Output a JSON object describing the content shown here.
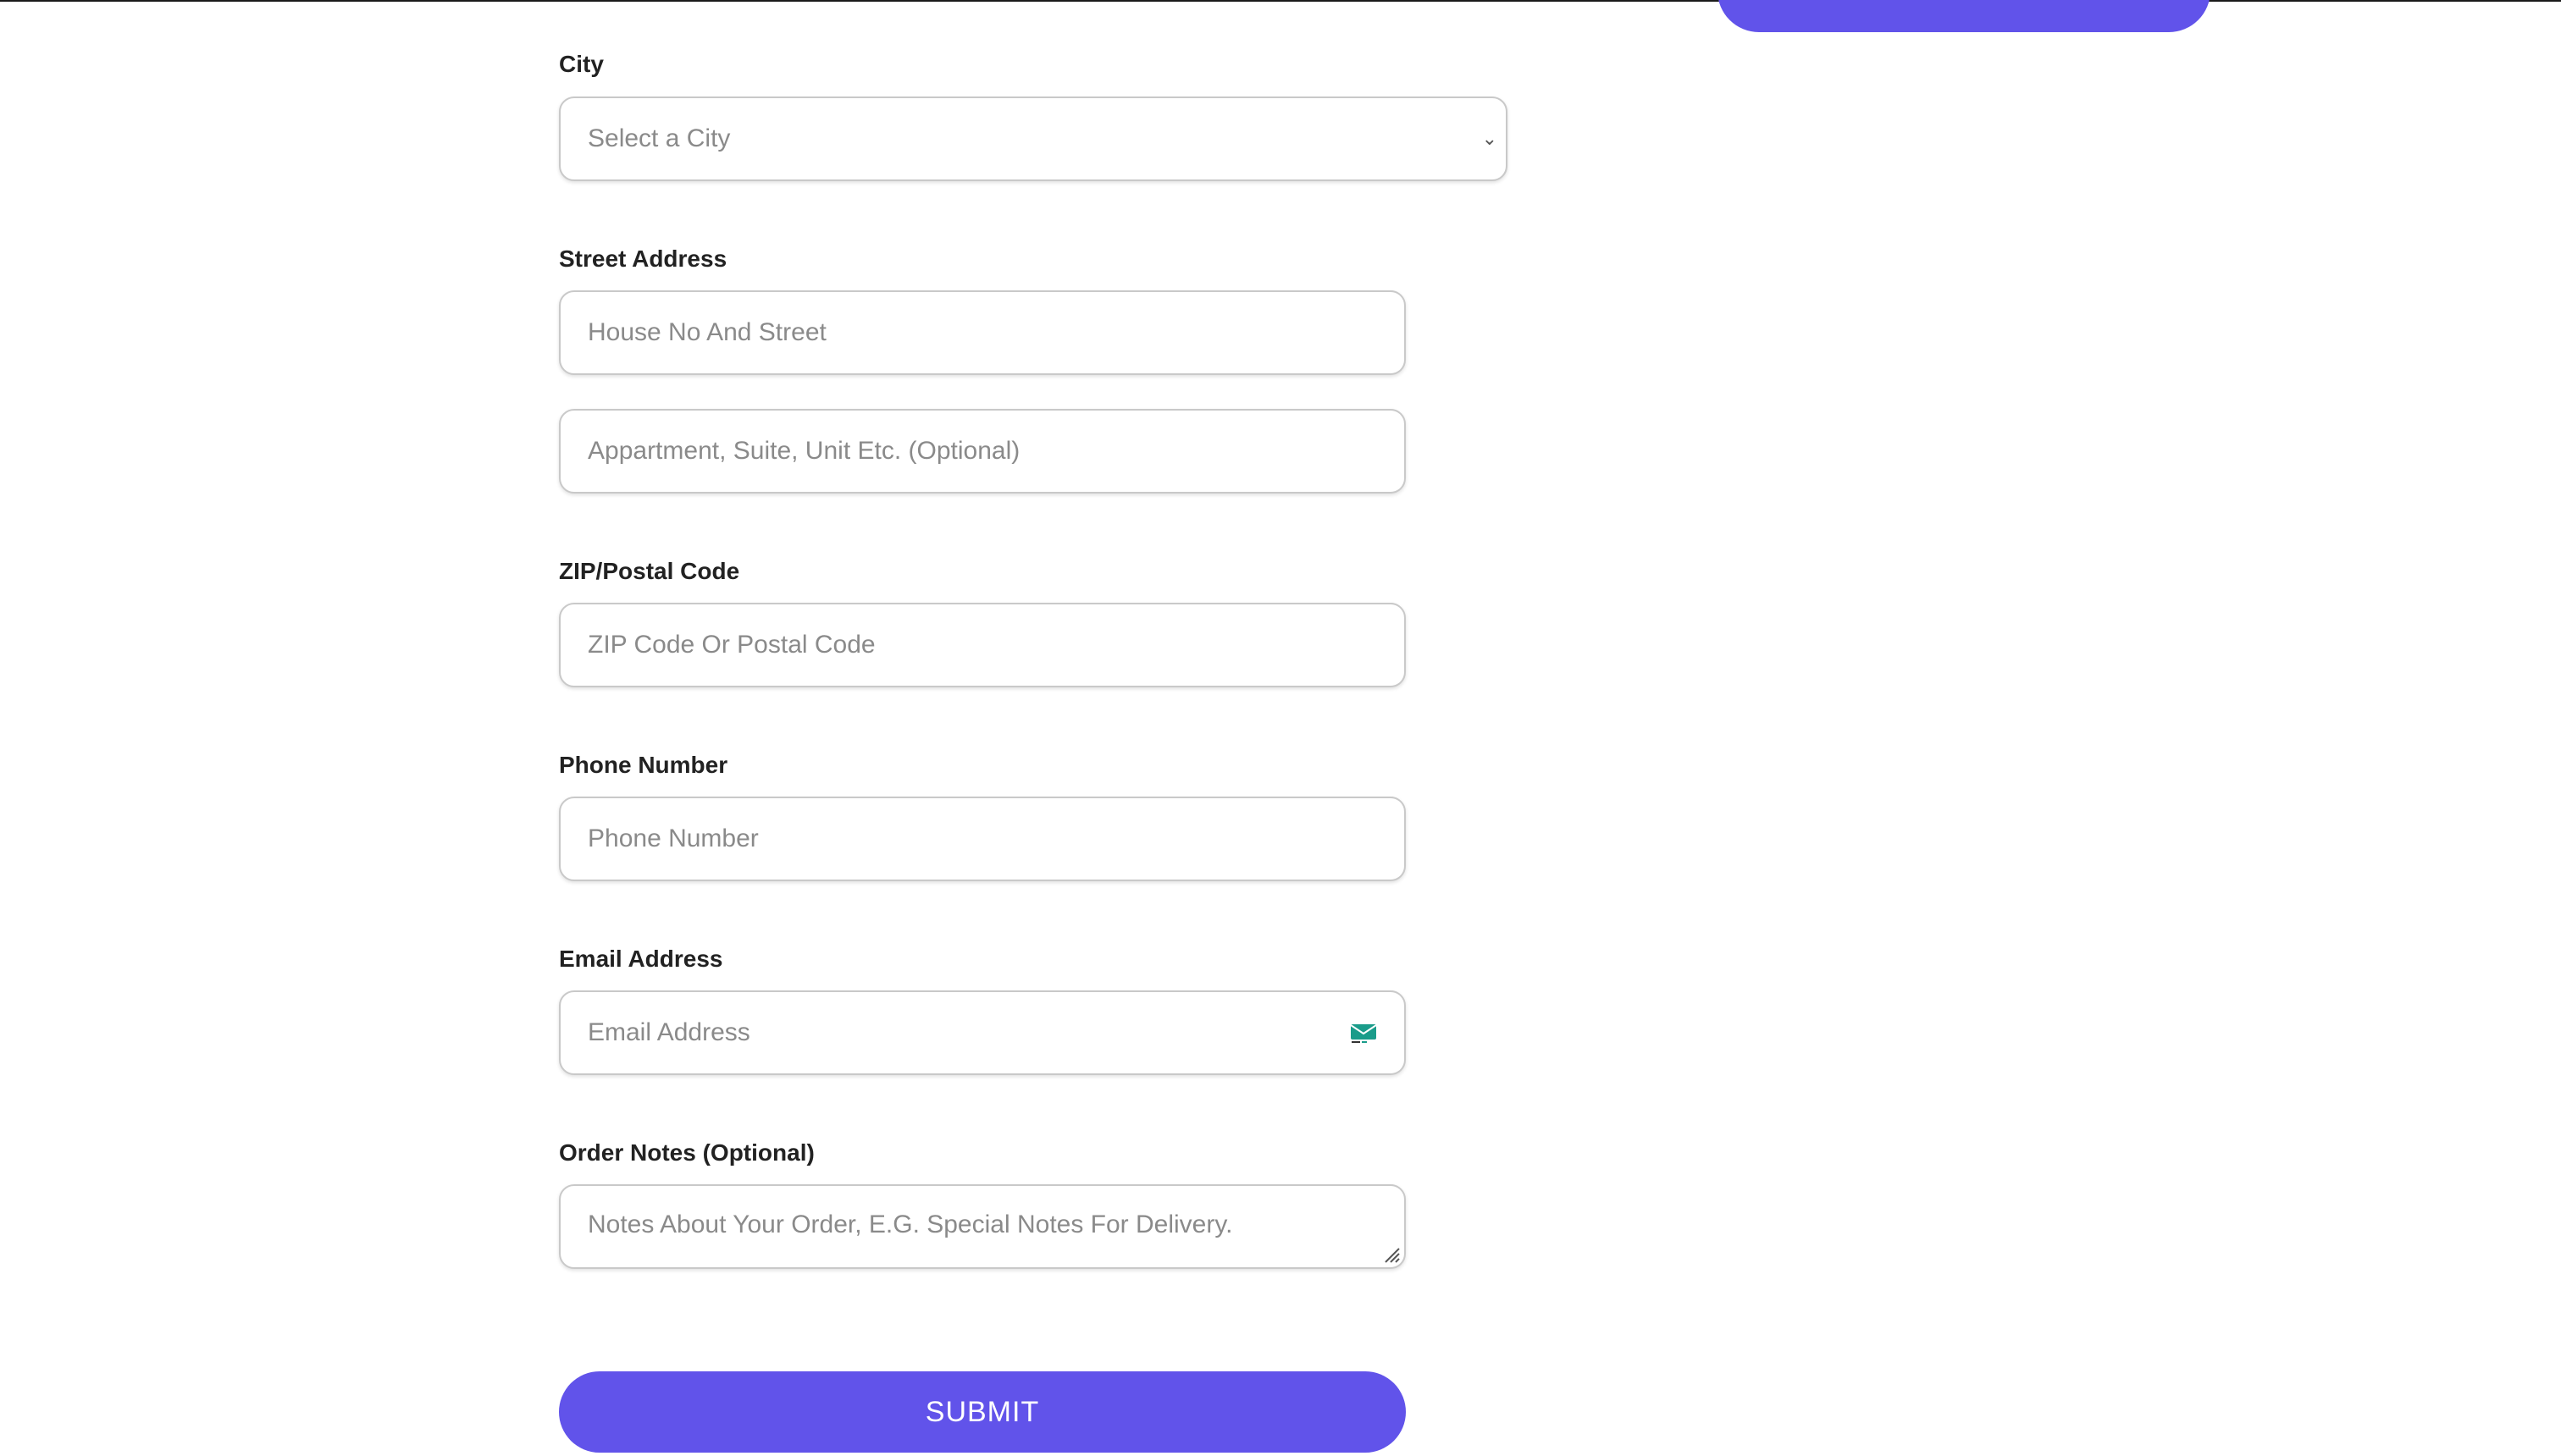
{
  "colors": {
    "accent": "#6153ea",
    "field_border": "#c9c9c9",
    "placeholder": "#8a8a8a",
    "label": "#222222",
    "mail_icon": "#1a9c8a"
  },
  "form": {
    "city": {
      "label": "City",
      "selected": "Select a City"
    },
    "street": {
      "label": "Street Address",
      "line1_placeholder": "House No And Street",
      "line2_placeholder": "Appartment, Suite, Unit Etc. (Optional)"
    },
    "zip": {
      "label": "ZIP/Postal Code",
      "placeholder": "ZIP Code Or Postal Code"
    },
    "phone": {
      "label": "Phone Number",
      "placeholder": "Phone Number"
    },
    "email": {
      "label": "Email Address",
      "placeholder": "Email Address",
      "icon": "mail-icon"
    },
    "notes": {
      "label": "Order Notes (Optional)",
      "placeholder": "Notes About Your Order, E.G. Special Notes For Delivery."
    },
    "submit_label": "SUBMIT"
  },
  "header": {
    "partial_button_color": "#6153ea"
  }
}
